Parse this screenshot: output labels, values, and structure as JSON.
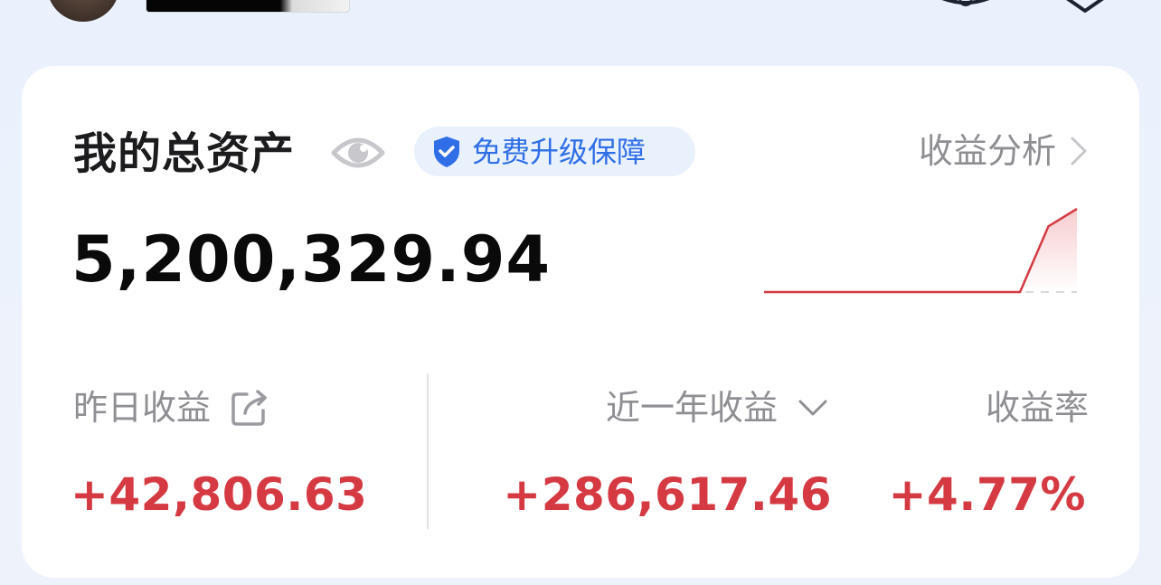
{
  "header": {
    "icons": [
      "avatar",
      "banner-image",
      "bell-icon",
      "shield-icon"
    ]
  },
  "card": {
    "title": "我的总资产",
    "upgrade_badge": "免费升级保障",
    "analysis_link": "收益分析",
    "total_assets": "5,200,329.94",
    "stats": {
      "yesterday_label": "昨日收益",
      "yesterday_value": "+42,806.63",
      "year_label": "近一年收益",
      "year_value": "+286,617.46",
      "rate_label": "收益率",
      "rate_value": "+4.77%"
    },
    "trend_values": [
      0,
      0,
      0,
      0,
      0,
      0,
      0,
      0,
      0,
      0,
      0.79,
      1.0
    ]
  },
  "colors": {
    "accent_blue": "#2f6ee6",
    "positive_red": "#d53a43",
    "muted_gray": "#8e8e93",
    "pill_bg": "#e9f1fd"
  }
}
